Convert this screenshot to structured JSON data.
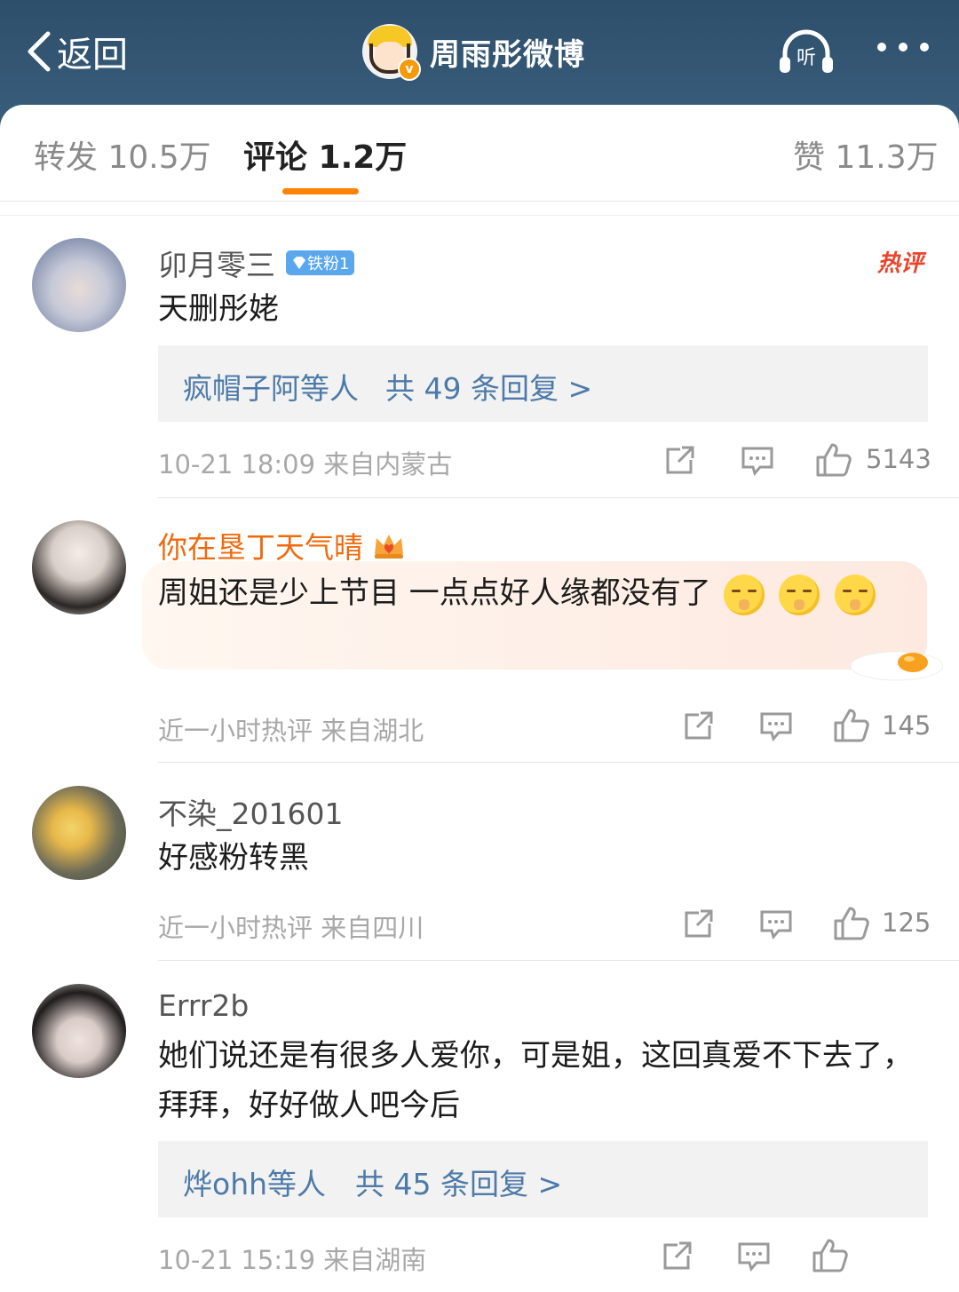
{
  "header": {
    "back_label": "返回",
    "title": "周雨彤微博",
    "listen_label": "听"
  },
  "tabs": {
    "repost": "转发 10.5万",
    "comment": "评论 1.2万",
    "like": "赞 11.3万"
  },
  "comments": [
    {
      "name": "卯月零三",
      "badge": "铁粉1",
      "hot_label": "热评",
      "text": "天删彤姥",
      "replies": {
        "who": "疯帽子阿等人",
        "count": "共 49 条回复 >"
      },
      "meta": "10-21 18:09  来自内蒙古",
      "likes": "5143"
    },
    {
      "name": "你在垦丁天气晴",
      "text": "周姐还是少上节目  一点点好人缘都没有了",
      "meta": "近一小时热评  来自湖北",
      "likes": "145"
    },
    {
      "name": "不染_201601",
      "text": "好感粉转黑",
      "meta": "近一小时热评  来自四川",
      "likes": "125"
    },
    {
      "name": "Errr2b",
      "text": "她们说还是有很多人爱你，可是姐，这回真爱不下去了，拜拜，好好做人吧今后",
      "replies": {
        "who": "烨ohh等人",
        "count": "共 45 条回复 >"
      },
      "meta": "10-21 15:19  来自湖南"
    }
  ],
  "colors": {
    "header_bg": "#34566f",
    "accent_orange": "#ff8200",
    "link_blue": "#4d7aa8",
    "vip_name": "#f06a0c",
    "hot_red": "#e9452c"
  }
}
